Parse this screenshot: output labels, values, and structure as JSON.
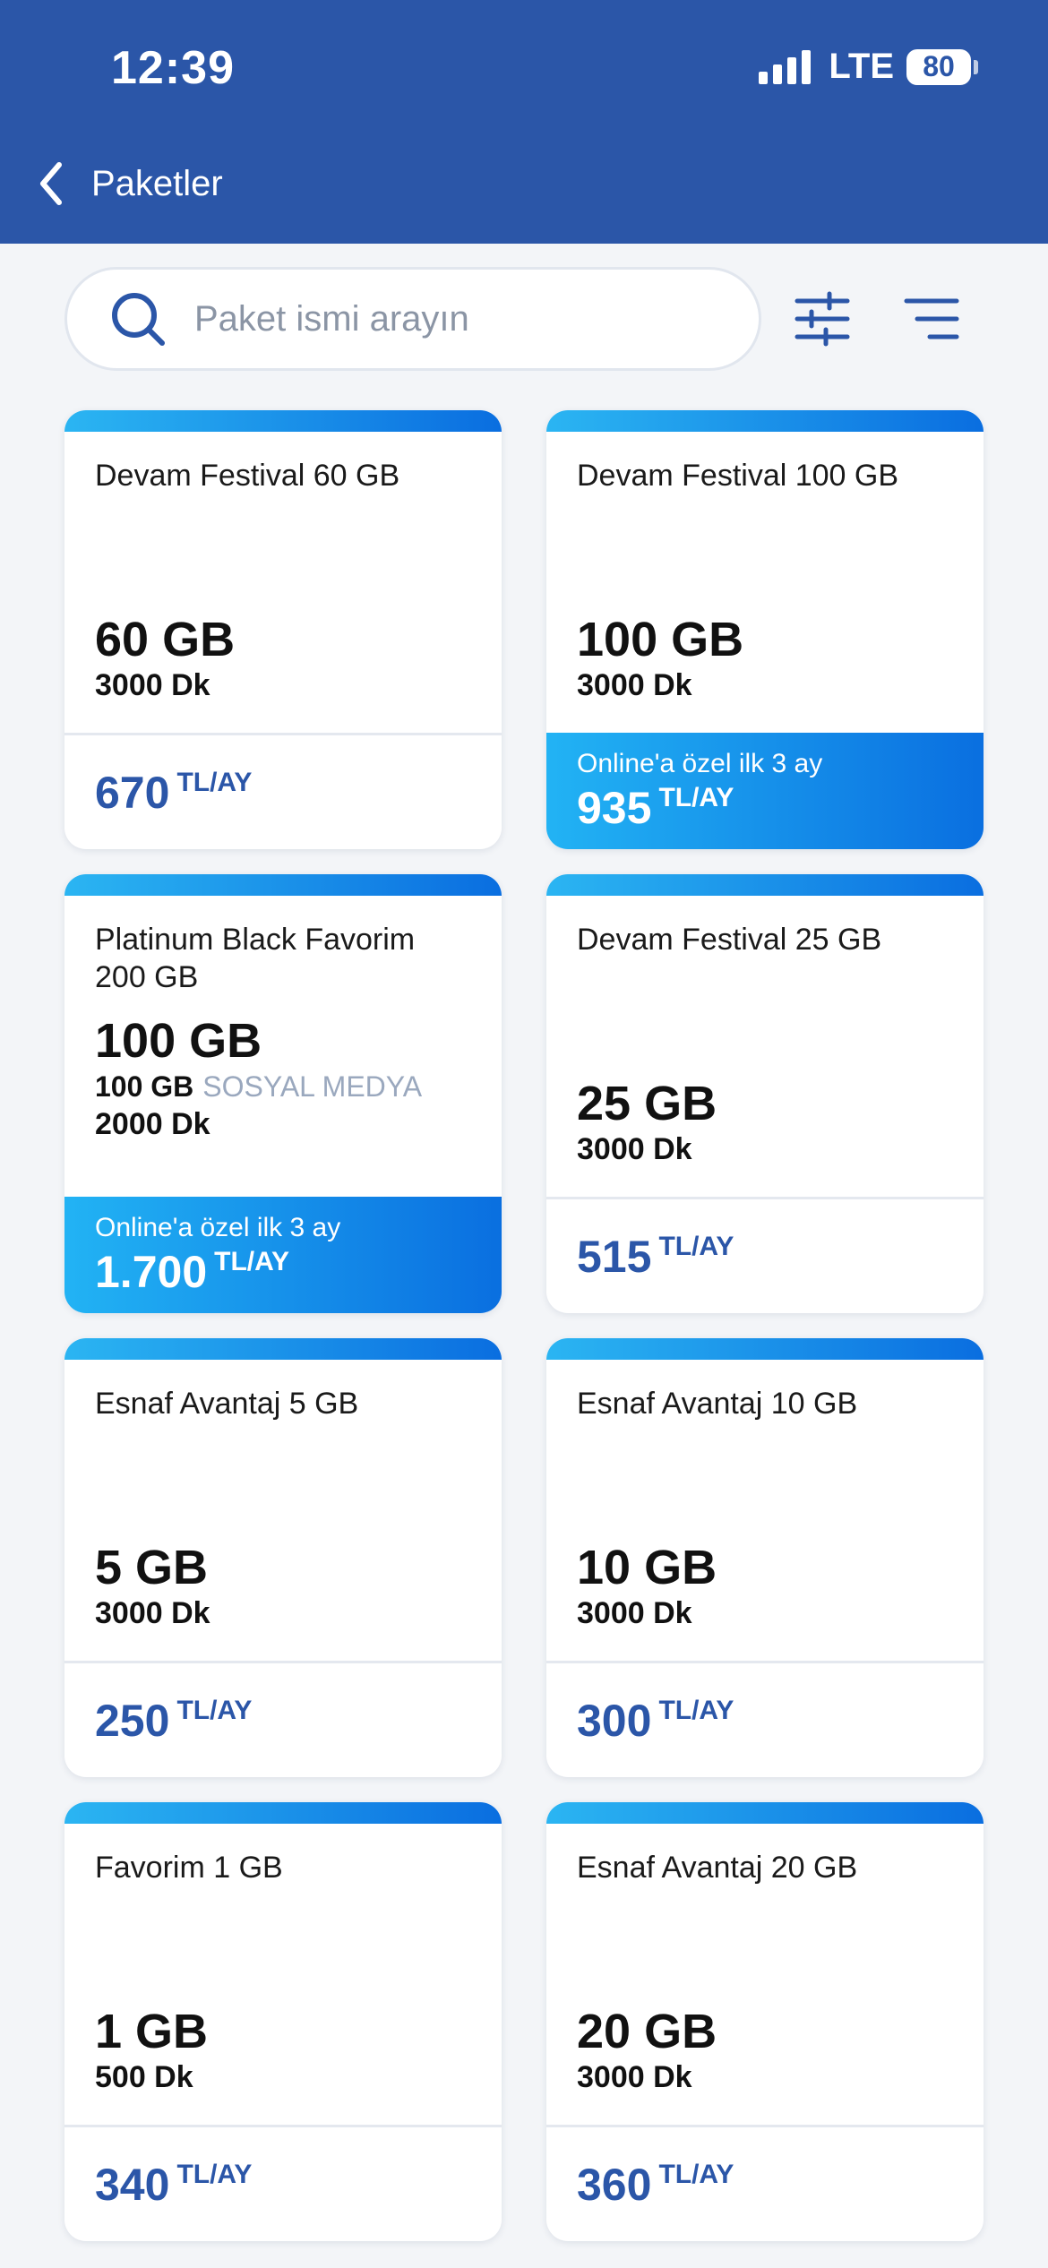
{
  "status": {
    "time": "12:39",
    "network": "LTE",
    "battery": "80"
  },
  "header": {
    "title": "Paketler"
  },
  "search": {
    "placeholder": "Paket ismi arayın"
  },
  "packages": [
    {
      "name": "Devam Festival 60 GB",
      "data": "60 GB",
      "minutes": "3000 Dk",
      "price": "670",
      "unit": "TL/AY"
    },
    {
      "name": "Devam Festival 100 GB",
      "data": "100 GB",
      "minutes": "3000 Dk",
      "promo": "Online'a özel ilk 3 ay",
      "price": "935",
      "unit": "TL/AY"
    },
    {
      "name": "Platinum Black Favorim 200 GB",
      "data": "100 GB",
      "social_data": "100 GB",
      "social_label": "SOSYAL MEDYA",
      "minutes": "2000 Dk",
      "promo": "Online'a özel ilk 3 ay",
      "price": "1.700",
      "unit": "TL/AY"
    },
    {
      "name": "Devam Festival 25 GB",
      "data": "25 GB",
      "minutes": "3000 Dk",
      "price": "515",
      "unit": "TL/AY"
    },
    {
      "name": "Esnaf Avantaj 5 GB",
      "data": "5 GB",
      "minutes": "3000 Dk",
      "price": "250",
      "unit": "TL/AY"
    },
    {
      "name": "Esnaf Avantaj 10 GB",
      "data": "10 GB",
      "minutes": "3000 Dk",
      "price": "300",
      "unit": "TL/AY"
    },
    {
      "name": "Favorim 1 GB",
      "data": "1 GB",
      "minutes": "500 Dk",
      "price": "340",
      "unit": "TL/AY"
    },
    {
      "name": "Esnaf Avantaj 20 GB",
      "data": "20 GB",
      "minutes": "3000 Dk",
      "price": "360",
      "unit": "TL/AY"
    }
  ],
  "colors": {
    "brand": "#2b56a8",
    "accent": "#1e90ea",
    "background": "#f3f5f8"
  },
  "icons": {
    "back": "chevron-left-icon",
    "search": "search-icon",
    "filter": "sliders-icon",
    "sort": "sort-lines-icon"
  }
}
